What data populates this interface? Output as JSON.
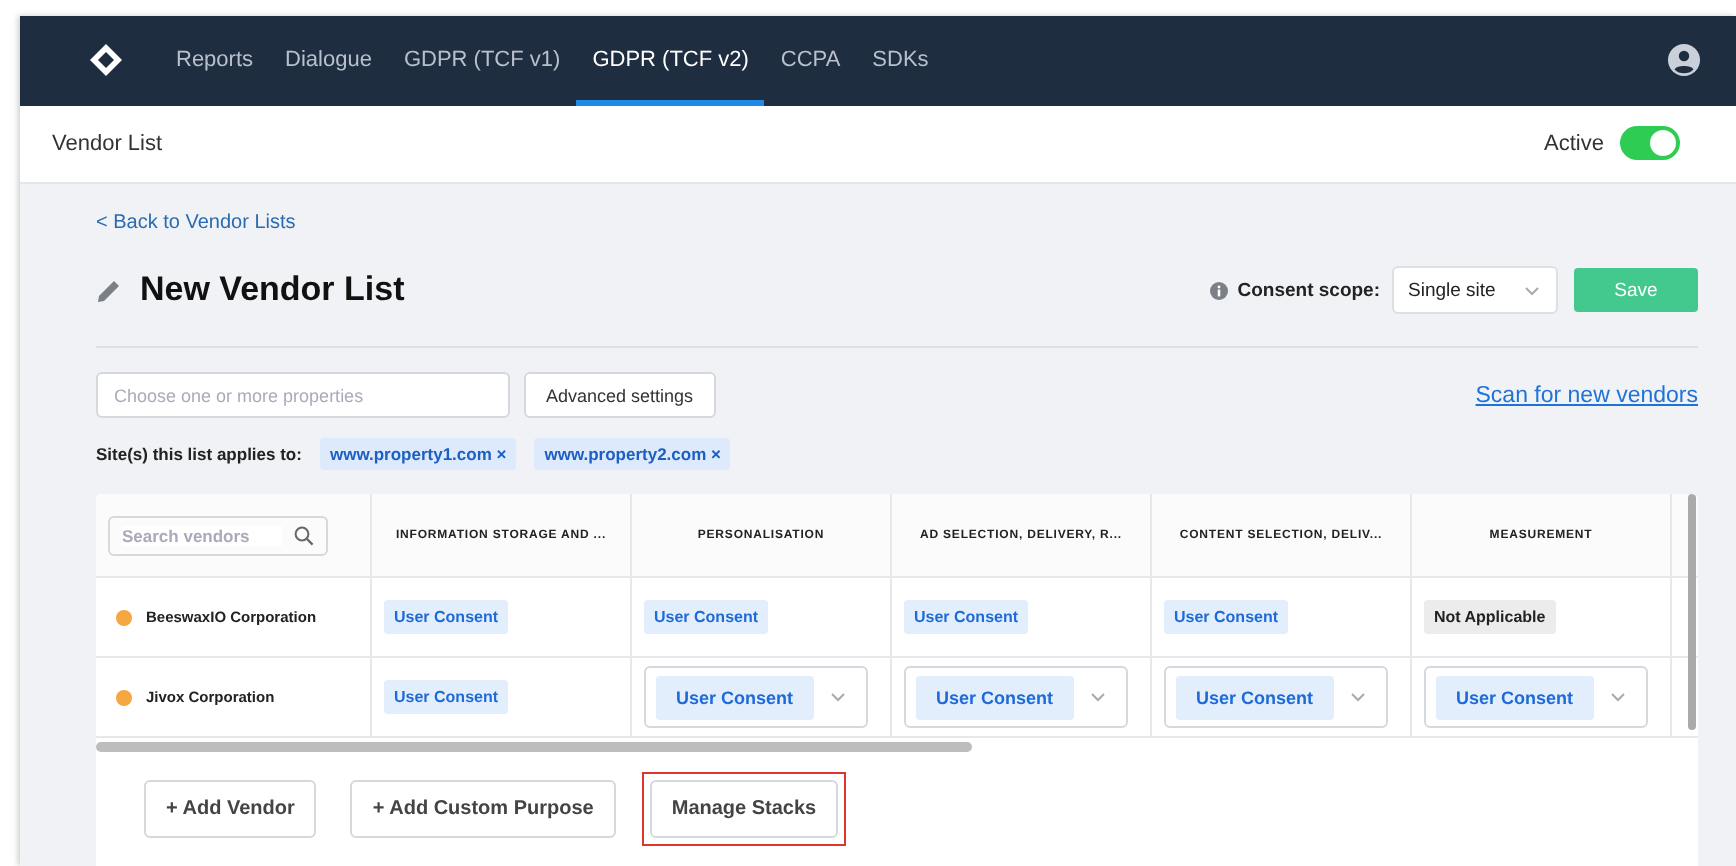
{
  "nav": {
    "tabs": [
      {
        "label": "Reports",
        "selected": false
      },
      {
        "label": "Dialogue",
        "selected": false
      },
      {
        "label": "GDPR (TCF v1)",
        "selected": false
      },
      {
        "label": "GDPR (TCF v2)",
        "selected": true
      },
      {
        "label": "CCPA",
        "selected": false
      },
      {
        "label": "SDKs",
        "selected": false
      }
    ]
  },
  "subheader": {
    "title": "Vendor List",
    "active_label": "Active",
    "active": true
  },
  "back_link": "< Back to Vendor Lists",
  "title": "New Vendor List",
  "consent_scope": {
    "label": "Consent scope:",
    "value": "Single site"
  },
  "save_button": "Save",
  "properties": {
    "placeholder": "Choose one or more properties"
  },
  "advanced_button": "Advanced settings",
  "scan_link": "Scan for new vendors",
  "sites": {
    "label": "Site(s) this list applies to:",
    "tags": [
      "www.property1.com ×",
      "www.property2.com ×"
    ]
  },
  "table": {
    "search_placeholder": "Search vendors",
    "columns": [
      "INFORMATION STORAGE AND ...",
      "PERSONALISATION",
      "AD SELECTION, DELIVERY, R...",
      "CONTENT SELECTION, DELIV...",
      "MEASUREMENT"
    ],
    "rows": [
      {
        "vendor": "BeeswaxIO Corporation",
        "color": "#f5a742",
        "cells": [
          {
            "kind": "badge",
            "text": "User Consent"
          },
          {
            "kind": "badge",
            "text": "User Consent"
          },
          {
            "kind": "badge",
            "text": "User Consent"
          },
          {
            "kind": "badge",
            "text": "User Consent"
          },
          {
            "kind": "na",
            "text": "Not Applicable"
          }
        ]
      },
      {
        "vendor": "Jivox Corporation",
        "color": "#f5a742",
        "cells": [
          {
            "kind": "badge",
            "text": "User Consent"
          },
          {
            "kind": "select",
            "text": "User Consent"
          },
          {
            "kind": "select",
            "text": "User Consent"
          },
          {
            "kind": "select",
            "text": "User Consent"
          },
          {
            "kind": "select",
            "text": "User Consent"
          }
        ]
      }
    ]
  },
  "footer_buttons": [
    {
      "label": "+ Add Vendor",
      "highlighted": false
    },
    {
      "label": "+ Add Custom Purpose",
      "highlighted": false
    },
    {
      "label": "Manage Stacks",
      "highlighted": true
    }
  ]
}
